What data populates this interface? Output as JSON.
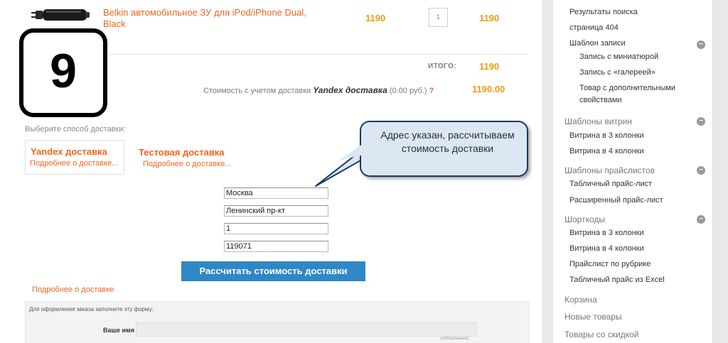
{
  "product": {
    "icon": "car-charger-icon",
    "name": "Belkin автомобильное ЗУ для iPod/iPhone Dual, Black",
    "price": "1190",
    "quantity": "1",
    "sum": "1190"
  },
  "totals": {
    "label": "ИТОГО:",
    "value": "1190",
    "delivery_prefix": "Стоимость с учетом доставки",
    "delivery_method": "Yandex доставка",
    "delivery_cost": "(0.00 руб.)",
    "question_mark": "?",
    "delivery_total": "1190.00"
  },
  "step_badge": "9",
  "delivery": {
    "choose_label": "Выберите способ доставки:",
    "methods": [
      {
        "title": "Yandex доставка",
        "link": "Подробнее о доставке..."
      },
      {
        "title": "Тестовая доставка",
        "link": "Подробнее о доставке..."
      }
    ]
  },
  "bubble_text": "Адрес указан, рассчитываем стоимость доставки",
  "address": {
    "city": "Москва",
    "street": "Ленинский пр-кт",
    "house": "1",
    "zip": "119071"
  },
  "calc_button": "Рассчитать стоимость доставки",
  "more_delivery": "Подробнее о доставке",
  "order_form": {
    "header": "Для оформления заказа заполните эту форму:",
    "name_label": "Ваше имя",
    "required_note": "(обязательно)"
  },
  "sidebar": {
    "items": [
      {
        "label": "Результаты поиска"
      },
      {
        "label": "страница 404"
      },
      {
        "label": "Шаблон записи"
      }
    ],
    "template_subitems": [
      {
        "label": "Запись с миниатюрой"
      },
      {
        "label": "Запись с «галереей»"
      },
      {
        "label": "Товар с дополнительными свойствами"
      }
    ],
    "groups": [
      {
        "title": "Шаблоны витрин",
        "items": [
          "Витрина в 3 колонки",
          "Витрина в 4 колонки"
        ]
      },
      {
        "title": "Шаблоны прайслистов",
        "items": [
          "Табличный прайс-лист",
          "Расширенный прайс-лист"
        ]
      },
      {
        "title": "Шорткоды",
        "items": [
          "Витрина в 3 колонки",
          "Витрина в 4 колонки",
          "Прайслист по рубрике",
          "Табличный прайс из Excel"
        ]
      }
    ],
    "bottom_links": [
      "Корзина",
      "Новые товары",
      "Товары со скидкой"
    ],
    "collapse_symbol": "−"
  },
  "colors": {
    "accent": "#f0641e",
    "price": "#f09a12",
    "button": "#2f87c5",
    "bubble_bg": "#dde7f1",
    "bubble_border": "#163a63"
  }
}
